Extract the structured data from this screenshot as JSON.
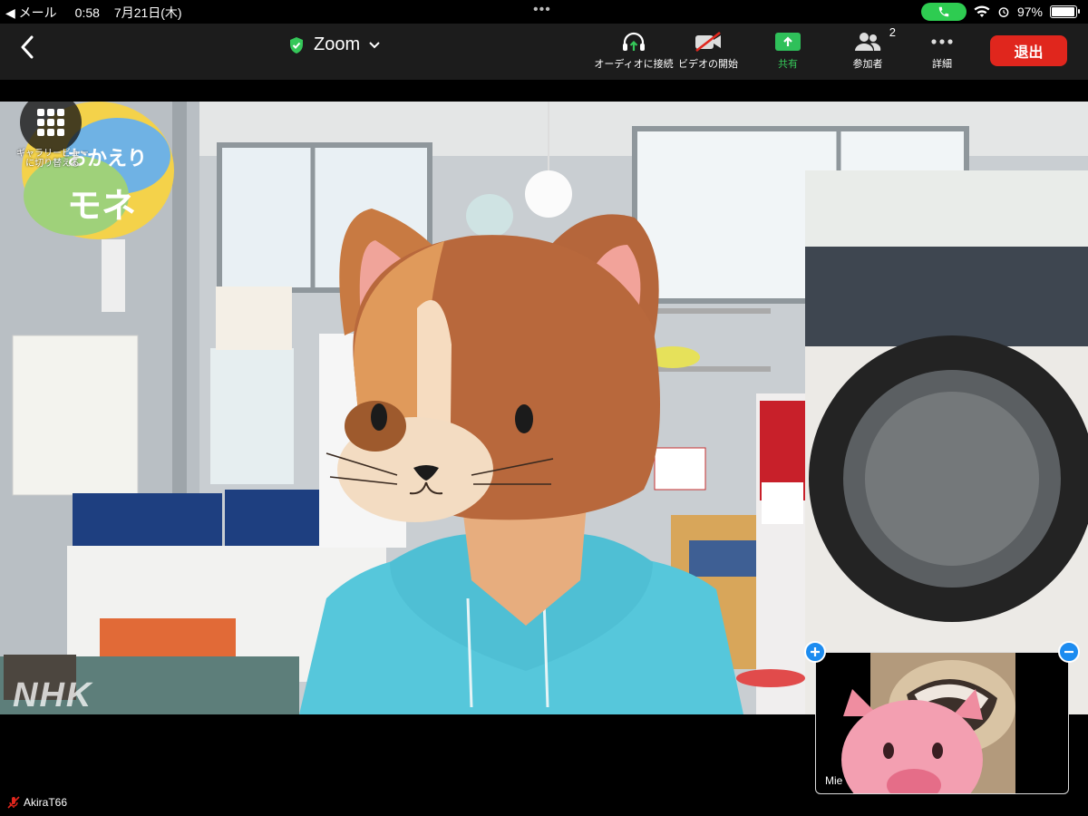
{
  "status_bar": {
    "back_app": "◀ メール",
    "time": "0:58",
    "date": "7月21日(木)",
    "battery": "97%",
    "battery_level": 0.97
  },
  "toolbar": {
    "title": "Zoom",
    "audio_label": "オーディオに接続",
    "video_label": "ビデオの開始",
    "share_label": "共有",
    "participants_label": "参加者",
    "participants_count": "2",
    "more_label": "詳細",
    "leave_label": "退出"
  },
  "video": {
    "gallery_label": "ギャラリービュー\nに切り替える",
    "watermark": "NHK",
    "logo_text": "おかえり\nモネ"
  },
  "self_view": {
    "name": "Mie"
  },
  "active_speaker": {
    "name": "AkiraT66"
  },
  "colors": {
    "leave": "#e0261d",
    "share": "#2fc05a",
    "shield": "#35c759",
    "pin": "#1d8cf0"
  }
}
